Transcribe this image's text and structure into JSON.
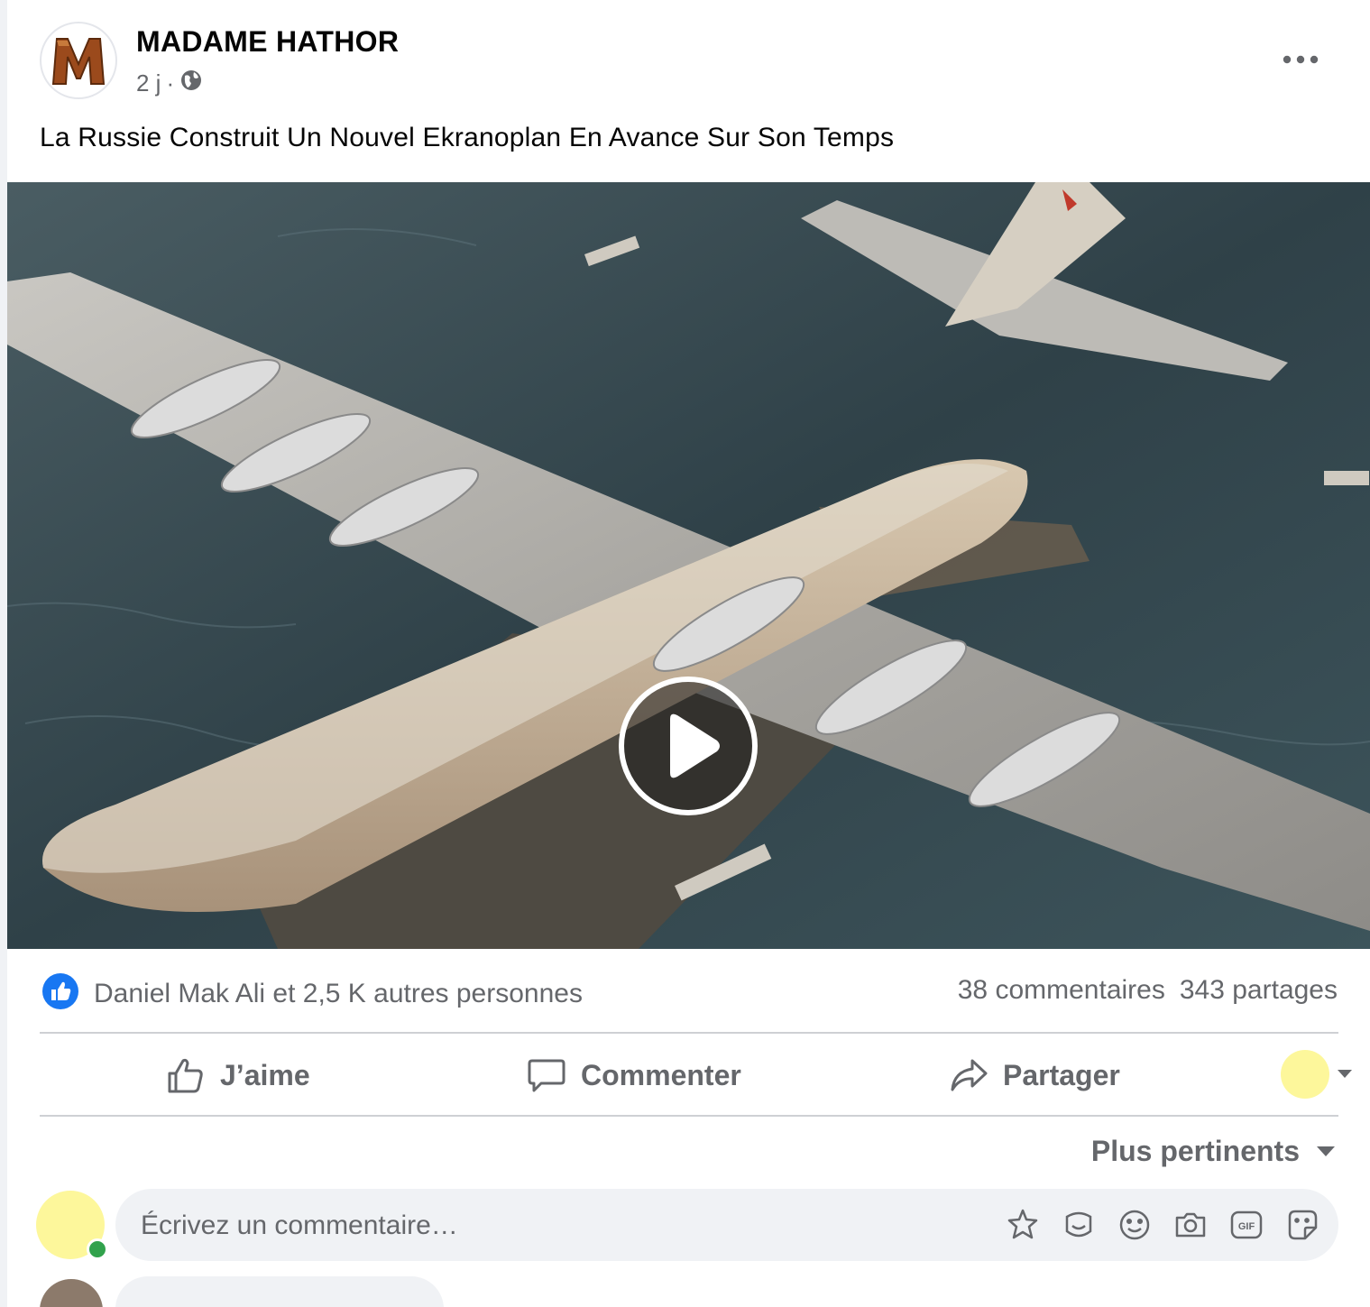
{
  "post": {
    "page_name": "MADAME HATHOR",
    "time_ago": "2 j",
    "separator": "·",
    "audience_icon": "globe-icon",
    "text": "La Russie Construit Un Nouvel Ekranoplan En Avance Sur Son Temps",
    "media": {
      "type": "video",
      "play_icon": "play-icon"
    }
  },
  "engagement": {
    "reaction_icon": "like-icon",
    "reactions_text": "Daniel Mak Ali et 2,5 K autres personnes",
    "comments_count": "38 commentaires",
    "shares_count": "343 partages"
  },
  "actions": {
    "like_label": "J’aime",
    "comment_label": "Commenter",
    "share_label": "Partager"
  },
  "comments": {
    "sort_label": "Plus pertinents",
    "composer_placeholder": "Écrivez un commentaire…",
    "composer_icons": [
      "avatar-sticker-icon",
      "sticker-icon",
      "emoji-icon",
      "camera-icon",
      "gif-icon",
      "smiley-sticker-icon"
    ]
  },
  "colors": {
    "brand_blue": "#1877f2",
    "secondary_text": "#65676b",
    "online_green": "#31a24c"
  }
}
